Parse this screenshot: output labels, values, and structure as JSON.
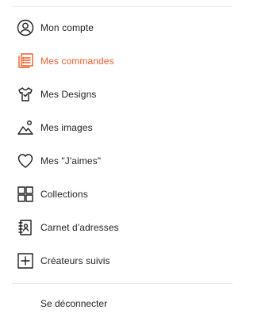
{
  "accent_color": "#f15a29",
  "menu": {
    "items": [
      {
        "label": "Mon compte",
        "icon": "user-circle-icon"
      },
      {
        "label": "Mes commandes",
        "icon": "orders-icon",
        "active": true
      },
      {
        "label": "Mes Designs",
        "icon": "tshirt-icon"
      },
      {
        "label": "Mes images",
        "icon": "image-icon"
      },
      {
        "label": "Mes \"J'aimes\"",
        "icon": "heart-icon"
      },
      {
        "label": "Collections",
        "icon": "grid-icon"
      },
      {
        "label": "Carnet d'adresses",
        "icon": "address-book-icon"
      },
      {
        "label": "Créateurs suivis",
        "icon": "plus-square-icon"
      }
    ]
  },
  "logout": {
    "label": "Se déconnecter"
  }
}
